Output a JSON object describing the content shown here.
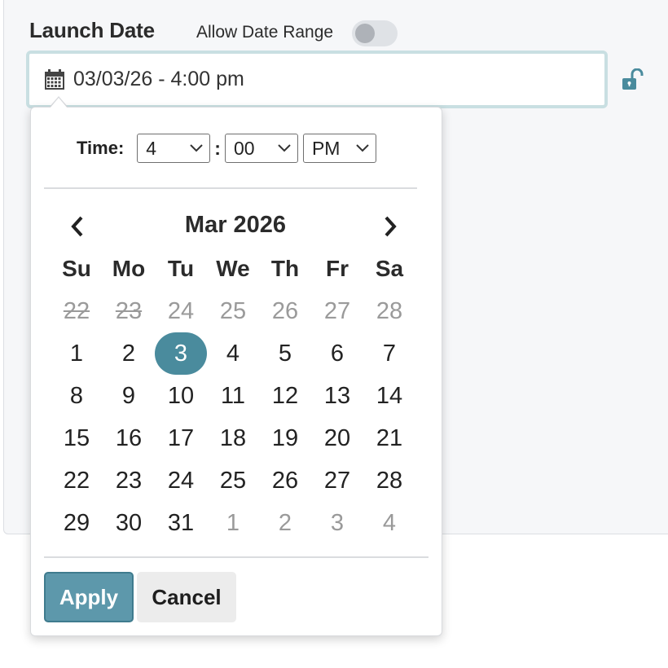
{
  "field": {
    "label": "Launch Date",
    "range_toggle_label": "Allow Date Range",
    "range_toggle_on": false,
    "input_value": "03/03/26 - 4:00 pm",
    "calendar_icon": "calendar-icon",
    "lock_icon": "unlocked-icon"
  },
  "picker": {
    "time_label": "Time:",
    "hour": "4",
    "minute": "00",
    "ampm": "PM",
    "month_title": "Mar 2026",
    "weekdays": [
      "Su",
      "Mo",
      "Tu",
      "We",
      "Th",
      "Fr",
      "Sa"
    ],
    "weeks": [
      [
        {
          "d": "22",
          "s": "disabled"
        },
        {
          "d": "23",
          "s": "disabled"
        },
        {
          "d": "24",
          "s": "other"
        },
        {
          "d": "25",
          "s": "other"
        },
        {
          "d": "26",
          "s": "other"
        },
        {
          "d": "27",
          "s": "other"
        },
        {
          "d": "28",
          "s": "other"
        }
      ],
      [
        {
          "d": "1",
          "s": ""
        },
        {
          "d": "2",
          "s": ""
        },
        {
          "d": "3",
          "s": "selected"
        },
        {
          "d": "4",
          "s": ""
        },
        {
          "d": "5",
          "s": ""
        },
        {
          "d": "6",
          "s": ""
        },
        {
          "d": "7",
          "s": ""
        }
      ],
      [
        {
          "d": "8",
          "s": ""
        },
        {
          "d": "9",
          "s": ""
        },
        {
          "d": "10",
          "s": ""
        },
        {
          "d": "11",
          "s": ""
        },
        {
          "d": "12",
          "s": ""
        },
        {
          "d": "13",
          "s": ""
        },
        {
          "d": "14",
          "s": ""
        }
      ],
      [
        {
          "d": "15",
          "s": ""
        },
        {
          "d": "16",
          "s": ""
        },
        {
          "d": "17",
          "s": ""
        },
        {
          "d": "18",
          "s": ""
        },
        {
          "d": "19",
          "s": ""
        },
        {
          "d": "20",
          "s": ""
        },
        {
          "d": "21",
          "s": ""
        }
      ],
      [
        {
          "d": "22",
          "s": ""
        },
        {
          "d": "23",
          "s": ""
        },
        {
          "d": "24",
          "s": ""
        },
        {
          "d": "25",
          "s": ""
        },
        {
          "d": "26",
          "s": ""
        },
        {
          "d": "27",
          "s": ""
        },
        {
          "d": "28",
          "s": ""
        }
      ],
      [
        {
          "d": "29",
          "s": ""
        },
        {
          "d": "30",
          "s": ""
        },
        {
          "d": "31",
          "s": ""
        },
        {
          "d": "1",
          "s": "other"
        },
        {
          "d": "2",
          "s": "other"
        },
        {
          "d": "3",
          "s": "other"
        },
        {
          "d": "4",
          "s": "other"
        }
      ]
    ],
    "apply_label": "Apply",
    "cancel_label": "Cancel"
  },
  "colors": {
    "accent": "#4a8b9d",
    "apply_bg": "#5d98ab",
    "muted_text": "#9a9a9a"
  }
}
